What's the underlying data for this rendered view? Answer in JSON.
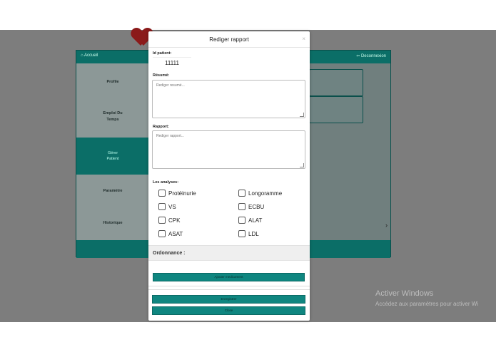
{
  "app": {
    "home_label": "Accueil",
    "logout_label": "Deconnexion",
    "sidebar": [
      {
        "label": "Profile",
        "active": false
      },
      {
        "label": "Emploi Du\nTemps",
        "active": false
      },
      {
        "label": "Gérer\nPatient",
        "active": true
      },
      {
        "label": "Paramètre",
        "active": false
      },
      {
        "label": "Historique",
        "active": false
      }
    ],
    "colors": {
      "teal": "#0b6e67",
      "overlay": "#7d7d7d",
      "logo": "#8b1a1a"
    }
  },
  "modal": {
    "title": "Rediger rapport",
    "close_icon": "×",
    "patient_id_label": "Id patient:",
    "patient_id_value": "11111",
    "resume_label": "Résumé:",
    "resume_placeholder": "Rediger resumé...",
    "rapport_label": "Rapport:",
    "rapport_placeholder": "Rediger rapport...",
    "analyses_label": "Les analyses:",
    "analyses_left": [
      "Protéinurie",
      "VS",
      "CPK",
      "ASAT"
    ],
    "analyses_right": [
      "Longoramme",
      "ECBU",
      "ALAT",
      "LDL"
    ],
    "ordonnance_label": "Ordonnance :",
    "add_medication_button": "Ajouter medicament",
    "save_button": "Enregistrer",
    "close_button": "Close"
  },
  "windows_watermark": {
    "title": "Activer Windows",
    "subtitle": "Accédez aux paramètres pour activer Wi"
  }
}
